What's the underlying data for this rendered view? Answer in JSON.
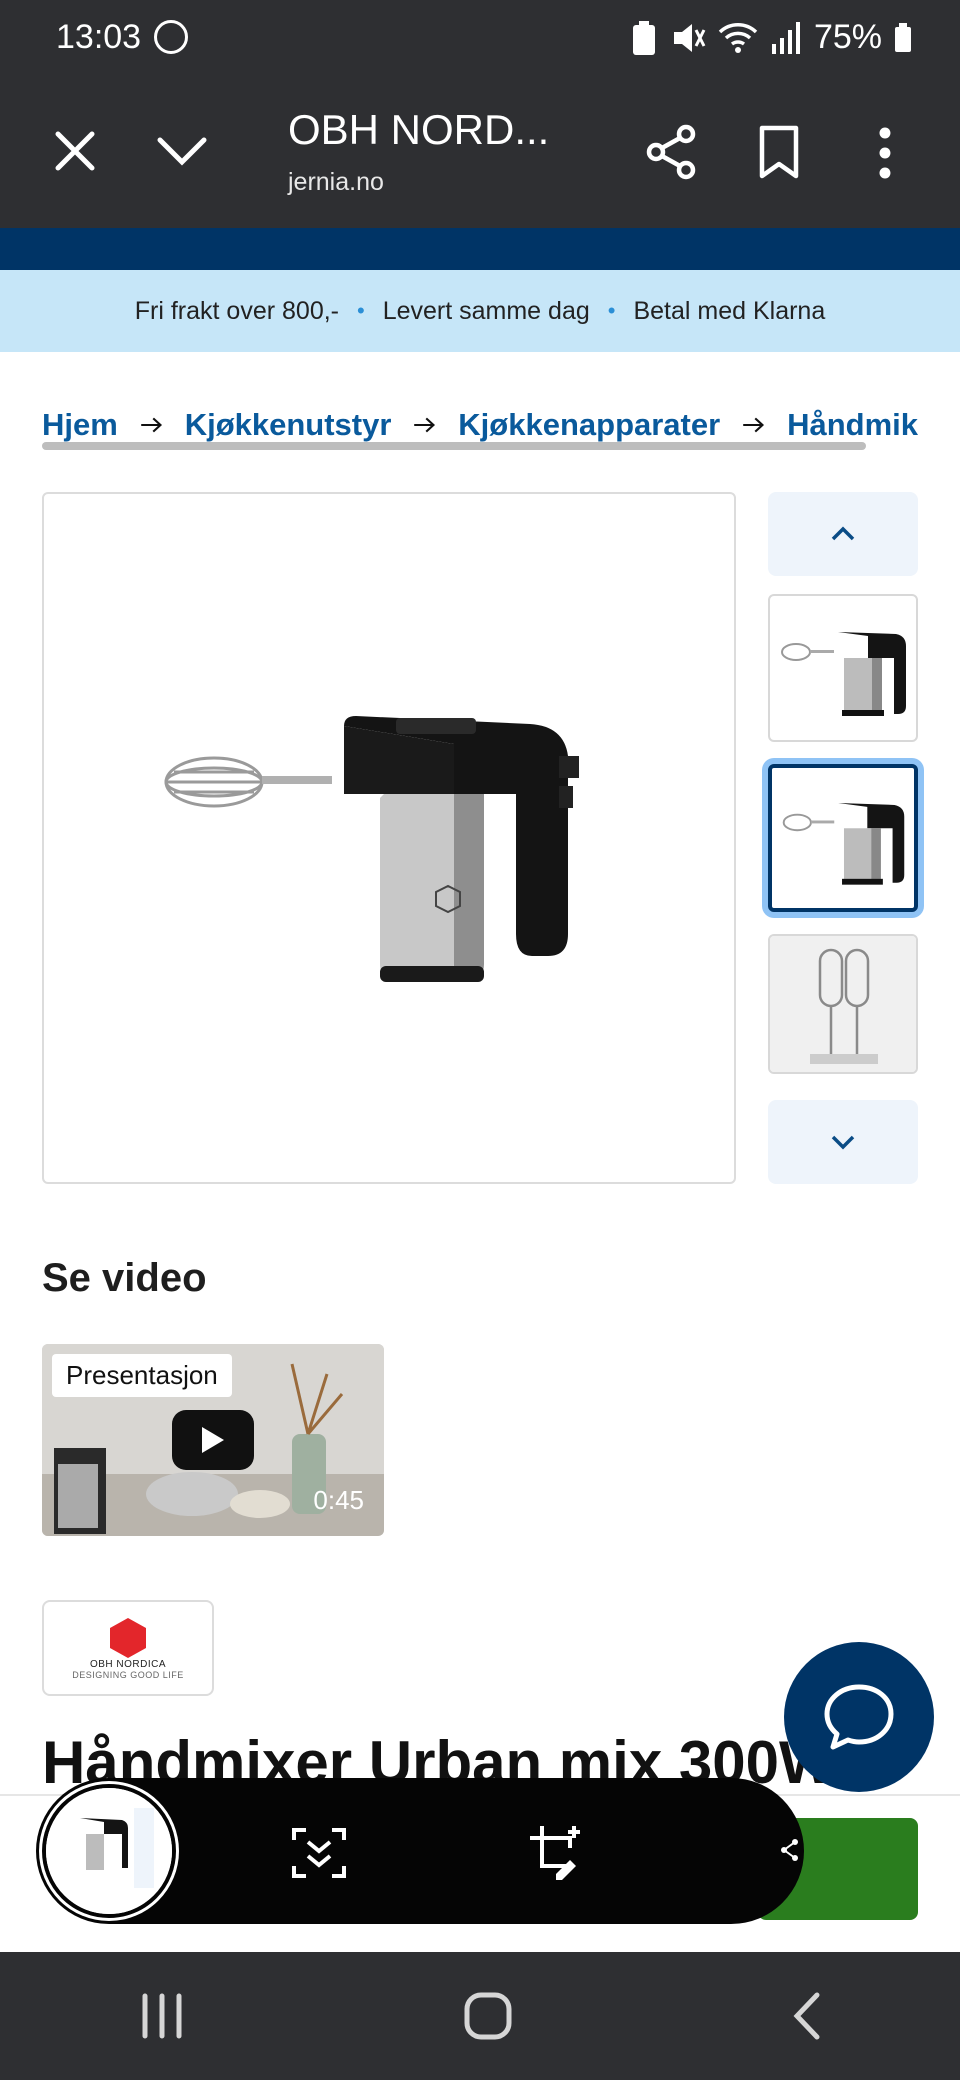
{
  "status": {
    "time": "13:03",
    "battery": "75%"
  },
  "browser": {
    "title": "OBH NORD...",
    "domain": "jernia.no"
  },
  "info_bar": {
    "items": [
      "Fri frakt over 800,-",
      "Levert samme dag",
      "Betal med Klarna"
    ]
  },
  "breadcrumb": {
    "items": [
      "Hjem",
      "Kjøkkenutstyr",
      "Kjøkkenapparater",
      "Håndmik"
    ]
  },
  "video_section": {
    "heading": "Se video",
    "label": "Presentasjon",
    "duration": "0:45"
  },
  "brand": {
    "name": "OBH NORDICA",
    "tagline": "DESIGNING GOOD LIFE"
  },
  "product": {
    "title": "Håndmixer Urban mix 300W"
  },
  "colors": {
    "navy": "#003466",
    "link": "#0a5a9c",
    "info_band": "#c6e6f8",
    "buy": "#2a7d1e",
    "brand_red": "#e3262b"
  }
}
